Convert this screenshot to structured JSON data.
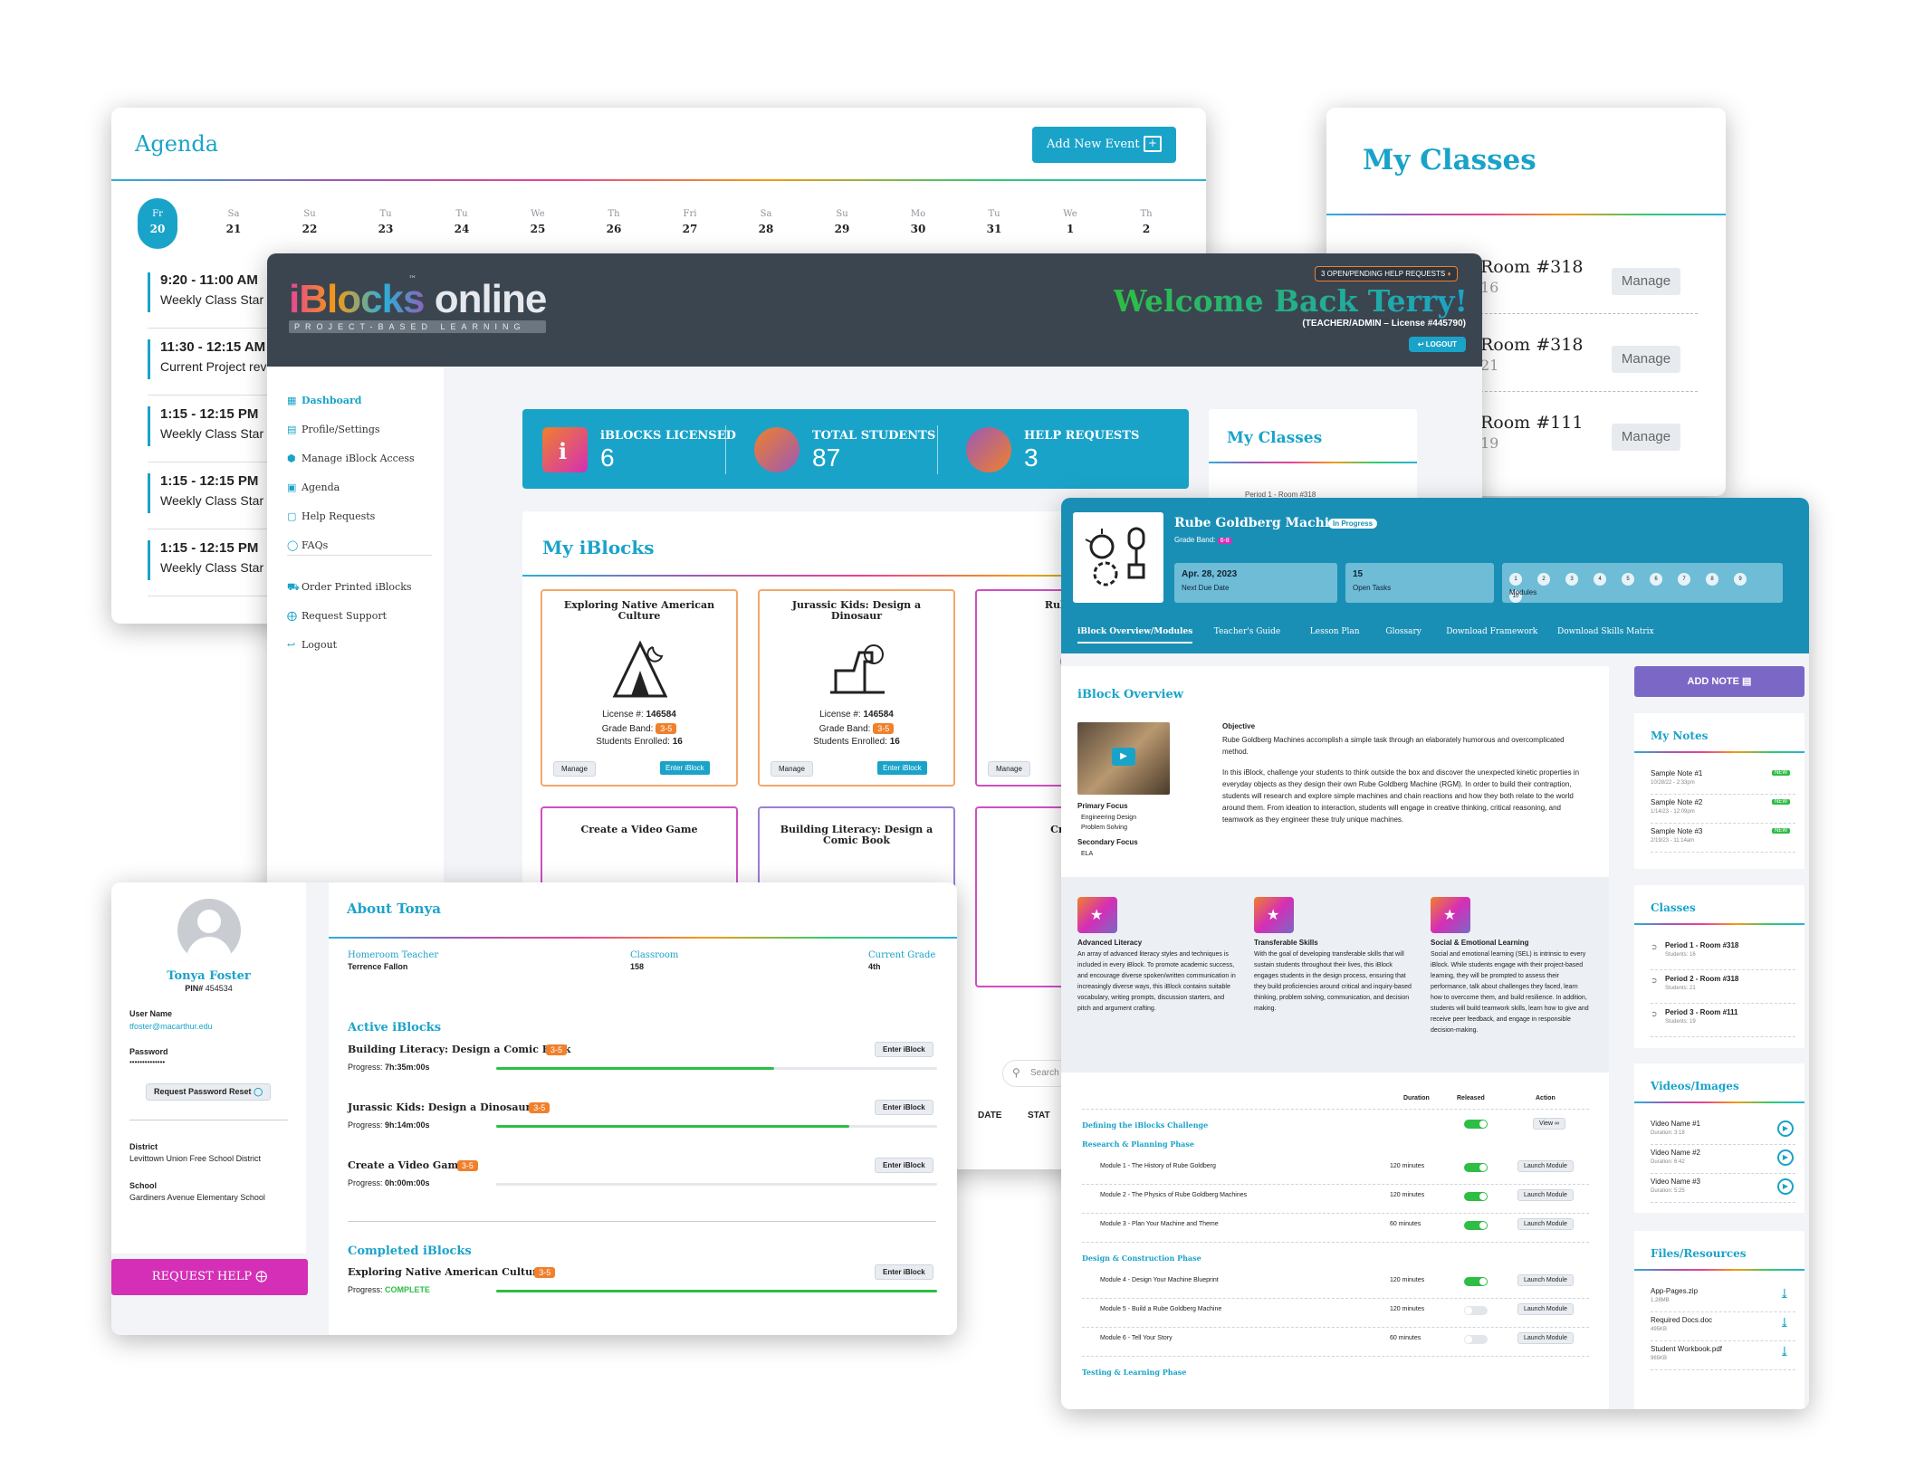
{
  "agenda": {
    "title": "Agenda",
    "add_button": "Add New Event",
    "days": [
      {
        "d": "Fr",
        "n": "20"
      },
      {
        "d": "Sa",
        "n": "21"
      },
      {
        "d": "Su",
        "n": "22"
      },
      {
        "d": "Tu",
        "n": "23"
      },
      {
        "d": "Tu",
        "n": "24"
      },
      {
        "d": "We",
        "n": "25"
      },
      {
        "d": "Th",
        "n": "26"
      },
      {
        "d": "Fri",
        "n": "27"
      },
      {
        "d": "Sa",
        "n": "28"
      },
      {
        "d": "Su",
        "n": "29"
      },
      {
        "d": "Mo",
        "n": "30"
      },
      {
        "d": "Tu",
        "n": "31"
      },
      {
        "d": "We",
        "n": "1"
      },
      {
        "d": "Th",
        "n": "2"
      }
    ],
    "events": [
      {
        "time": "9:20 - 11:00 AM",
        "label": "Weekly Class Star"
      },
      {
        "time": "11:30 - 12:15 AM",
        "label": "Current Project rev"
      },
      {
        "time": "1:15 - 12:15 PM",
        "label": "Weekly Class Star"
      },
      {
        "time": "1:15 - 12:15 PM",
        "label": "Weekly Class Star"
      },
      {
        "time": "1:15 - 12:15 PM",
        "label": "Weekly Class Star"
      }
    ]
  },
  "classes_bg": {
    "title": "My Classes",
    "manage": "Manage",
    "rows": [
      {
        "room": "Room #318",
        "count": "16"
      },
      {
        "room": "Room #318",
        "count": "21"
      },
      {
        "room": "Room #111",
        "count": "19"
      }
    ]
  },
  "dashboard": {
    "logo_main": "iBlocks online",
    "logo_tm": "™",
    "logo_sub": "PROJECT-BASED LEARNING",
    "help_pill": "3 OPEN/PENDING HELP REQUESTS",
    "welcome": "Welcome Back Terry!",
    "role": "(TEACHER/ADMIN – License #445790)",
    "logout": "LOGOUT",
    "nav": [
      "Dashboard",
      "Profile/Settings",
      "Manage iBlock Access",
      "Agenda",
      "Help Requests",
      "FAQs",
      "Order Printed iBlocks",
      "Request Support",
      "Logout"
    ],
    "stats": [
      {
        "label": "iBLOCKS LICENSED",
        "value": "6"
      },
      {
        "label": "TOTAL STUDENTS",
        "value": "87"
      },
      {
        "label": "HELP REQUESTS",
        "value": "3"
      }
    ],
    "my_iblocks_title": "My iBlocks",
    "my_classes_title": "My Classes",
    "my_classes_row": "Period 1 - Room #318",
    "lic_label": "License #:",
    "grade_label": "Grade Band:",
    "enrolled_label": "Students Enrolled:",
    "manage": "Manage",
    "enter": "Enter iBlock",
    "cards": [
      {
        "title": "Exploring Native American Culture",
        "license": "146584",
        "grade": "3-5",
        "enrolled": "16"
      },
      {
        "title": "Jurassic Kids: Design a Dinosaur",
        "license": "146584",
        "grade": "3-5",
        "enrolled": "16"
      },
      {
        "title": "Rube Gold",
        "license": "",
        "grade": "",
        "enrolled": ""
      }
    ],
    "cards2": [
      "Create a Video Game",
      "Building Literacy: Design a Comic Book",
      "Create a"
    ],
    "search": "Search",
    "date_col": "DATE",
    "status_col": "STAT"
  },
  "profile": {
    "name": "Tonya Foster",
    "pin_label": "PIN#",
    "pin": "454534",
    "username_label": "User Name",
    "username": "tfoster@macarthur.edu",
    "password_label": "Password",
    "password": "••••••••••••••",
    "reset": "Request Password Reset",
    "district_label": "District",
    "district": "Levittown Union Free School District",
    "school_label": "School",
    "school": "Gardiners Avenue Elementary School",
    "request_help": "REQUEST HELP",
    "about_title": "About Tonya",
    "homeroom_label": "Homeroom Teacher",
    "homeroom": "Terrence Fallon",
    "classroom_label": "Classroom",
    "classroom": "158",
    "grade_label": "Current Grade",
    "grade": "4th",
    "active_title": "Active iBlocks",
    "completed_title": "Completed iBlocks",
    "enter": "Enter iBlock",
    "progress_label": "Progress:",
    "active": [
      {
        "title": "Building Literacy: Design a Comic Book",
        "band": "3-5",
        "progress": "7h:35m:00s",
        "pct": 0.63
      },
      {
        "title": "Jurassic Kids: Design a Dinosaur",
        "band": "3-5",
        "progress": "9h:14m:00s",
        "pct": 0.8
      },
      {
        "title": "Create a Video Game",
        "band": "3-5",
        "progress": "0h:00m:00s",
        "pct": 0
      }
    ],
    "completed": [
      {
        "title": "Exploring Native American Culture",
        "band": "3-5",
        "progress": "COMPLETE",
        "pct": 1
      }
    ]
  },
  "detail": {
    "title": "Rube Goldberg Machines",
    "status": "In Progress",
    "grade_label": "Grade Band:",
    "grade": "6-8",
    "due_date": "Apr. 28, 2023",
    "due_label": "Next Due Date",
    "tasks": "15",
    "tasks_label": "Open Tasks",
    "modules_label": "Modules",
    "modules": [
      "1",
      "2",
      "3",
      "4",
      "5",
      "6",
      "7",
      "8",
      "9",
      "10"
    ],
    "tabs": [
      "iBlock Overview/Modules",
      "Teacher's Guide",
      "Lesson Plan",
      "Glossary",
      "Download Framework",
      "Download Skills Matrix"
    ],
    "overview_title": "iBlock Overview",
    "objective_label": "Objective",
    "objective_p1": "Rube Goldberg Machines accomplish a simple task through an elaborately humorous and overcomplicated method.",
    "objective_p2": "In this iBlock, challenge your students to think outside the box and discover the unexpected kinetic properties in everyday objects as they design their own Rube Goldberg Machine (RGM). In order to build their contraption, students will research and explore simple machines and chain reactions and how they both relate to the world around them. From ideation to interaction, students will engage in creative thinking, critical reasoning, and teamwork as they engineer these truly unique machines.",
    "primary_label": "Primary Focus",
    "primary": [
      "Engineering Design",
      "Problem Solving"
    ],
    "secondary_label": "Secondary Focus",
    "secondary": [
      "ELA"
    ],
    "skills": [
      {
        "title": "Advanced Literacy",
        "text": "An array of advanced literacy styles and techniques is included in every iBlock. To promote academic success, and encourage diverse spoken/written communication in increasingly diverse ways, this iBlock contains suitable vocabulary, writing prompts, discussion starters, and pitch and argument crafting."
      },
      {
        "title": "Transferable Skills",
        "text": "With the goal of developing transferable skills that will sustain students throughout their lives, this iBlock engages students in the design process, ensuring that they build proficiencies around critical and inquiry-based thinking, problem solving, communication, and decision making."
      },
      {
        "title": "Social & Emotional Learning",
        "text": "Social and emotional learning (SEL) is intrinsic to every iBlock. While students engage with their project-based learning, they will be prompted to assess their performance, talk about challenges they faced, learn how to overcome them, and build resilience. In addition, students will build teamwork skills, learn how to give and receive peer feedback, and engage in responsible decision-making."
      }
    ],
    "col_duration": "Duration",
    "col_released": "Released",
    "col_action": "Action",
    "challenge": "Defining the iBlocks Challenge",
    "view": "View",
    "phases": [
      {
        "name": "Research & Planning Phase",
        "modules": [
          {
            "name": "Module 1 - The History of Rube Goldberg",
            "dur": "120 minutes",
            "on": true
          },
          {
            "name": "Module 2 - The Physics of Rube Goldberg Machines",
            "dur": "120 minutes",
            "on": true
          },
          {
            "name": "Module 3 - Plan Your Machine and Theme",
            "dur": "60 minutes",
            "on": true
          }
        ]
      },
      {
        "name": "Design & Construction Phase",
        "modules": [
          {
            "name": "Module 4 - Design Your Machine Blueprint",
            "dur": "120 minutes",
            "on": true
          },
          {
            "name": "Module 5 - Build a Rube Goldberg Machine",
            "dur": "120 minutes",
            "on": false
          },
          {
            "name": "Module 6 - Tell Your Story",
            "dur": "60 minutes",
            "on": false
          }
        ]
      },
      {
        "name": "Testing & Learning Phase",
        "modules": []
      }
    ],
    "launch": "Launch Module",
    "add_note": "ADD NOTE",
    "notes_title": "My Notes",
    "new_badge": "NEW",
    "notes": [
      {
        "title": "Sample Note #1",
        "date": "10/28/22 - 2:33pm"
      },
      {
        "title": "Sample Note #2",
        "date": "1/14/23 - 12:09pm"
      },
      {
        "title": "Sample Note #3",
        "date": "2/19/23 - 11:14am"
      }
    ],
    "classes_title": "Classes",
    "classes": [
      {
        "name": "Period 1 - Room #318",
        "students": "Students: 16"
      },
      {
        "name": "Period 2 - Room #318",
        "students": "Students: 21"
      },
      {
        "name": "Period 3 - Room #111",
        "students": "Students: 19"
      }
    ],
    "videos_title": "Videos/Images",
    "videos": [
      {
        "name": "Video Name #1",
        "dur": "Duration: 3:18"
      },
      {
        "name": "Video Name #2",
        "dur": "Duration: 6:42"
      },
      {
        "name": "Video Name #3",
        "dur": "Duration: 5:25"
      }
    ],
    "files_title": "Files/Resources",
    "files": [
      {
        "name": "App-Pages.zip",
        "size": "1.28MB"
      },
      {
        "name": "Required Docs.doc",
        "size": "495KB"
      },
      {
        "name": "Student Workbook.pdf",
        "size": "965KB"
      }
    ]
  },
  "colors": {
    "teal": "#1aa3c9",
    "dark_header": "#3b4550",
    "green": "#2ebd45",
    "orange": "#f0802c",
    "magenta": "#d42fb6",
    "purple": "#7b68c6"
  }
}
